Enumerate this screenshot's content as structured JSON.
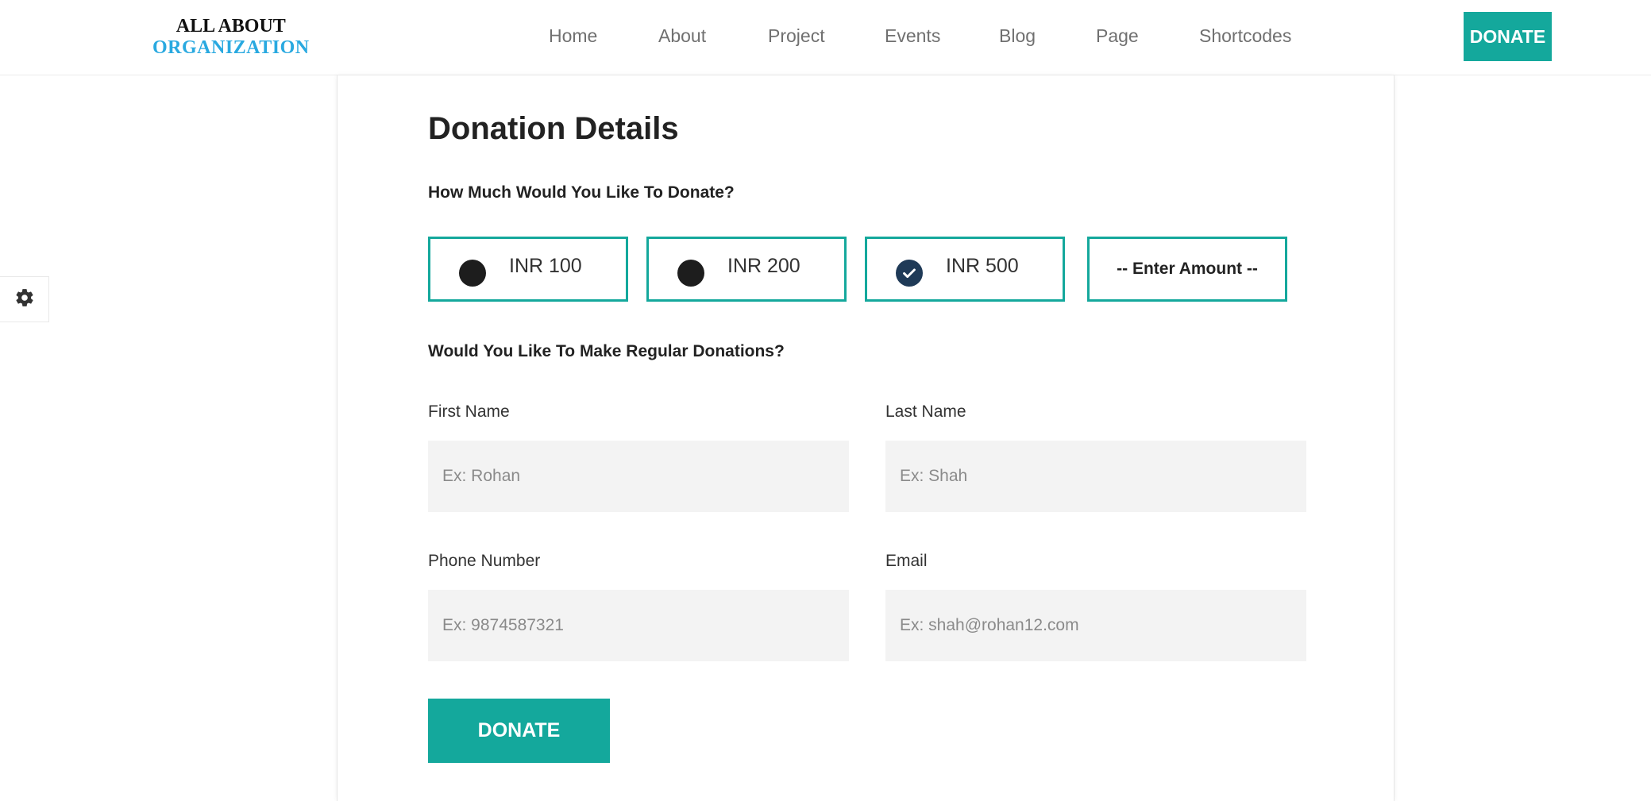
{
  "header": {
    "logo_line1": "ALL ABOUT",
    "logo_line2": "ORGANIZATION",
    "nav": [
      "Home",
      "About",
      "Project",
      "Events",
      "Blog",
      "Page",
      "Shortcodes"
    ],
    "donate_label": "DONATE"
  },
  "sidebar": {
    "settings_icon": "gear-icon"
  },
  "form": {
    "title": "Donation Details",
    "amount_question": "How Much Would You Like To Donate?",
    "amount_options": [
      {
        "label": "INR 100",
        "selected": false
      },
      {
        "label": "INR 200",
        "selected": false
      },
      {
        "label": "INR 500",
        "selected": true
      }
    ],
    "custom_amount_placeholder": "-- Enter Amount --",
    "regular_question": "Would You Like To Make Regular Donations?",
    "first_name": {
      "label": "First Name",
      "placeholder": "Ex: Rohan",
      "value": ""
    },
    "last_name": {
      "label": "Last Name",
      "placeholder": "Ex: Shah",
      "value": ""
    },
    "phone": {
      "label": "Phone Number",
      "placeholder": "Ex: 9874587321",
      "value": ""
    },
    "email": {
      "label": "Email",
      "placeholder": "Ex: shah@rohan12.com",
      "value": ""
    },
    "submit_label": "DONATE"
  },
  "colors": {
    "accent": "#14a89c",
    "logo_blue": "#29a9e0",
    "selected_check": "#1f3a57",
    "input_bg": "#f3f3f3"
  }
}
